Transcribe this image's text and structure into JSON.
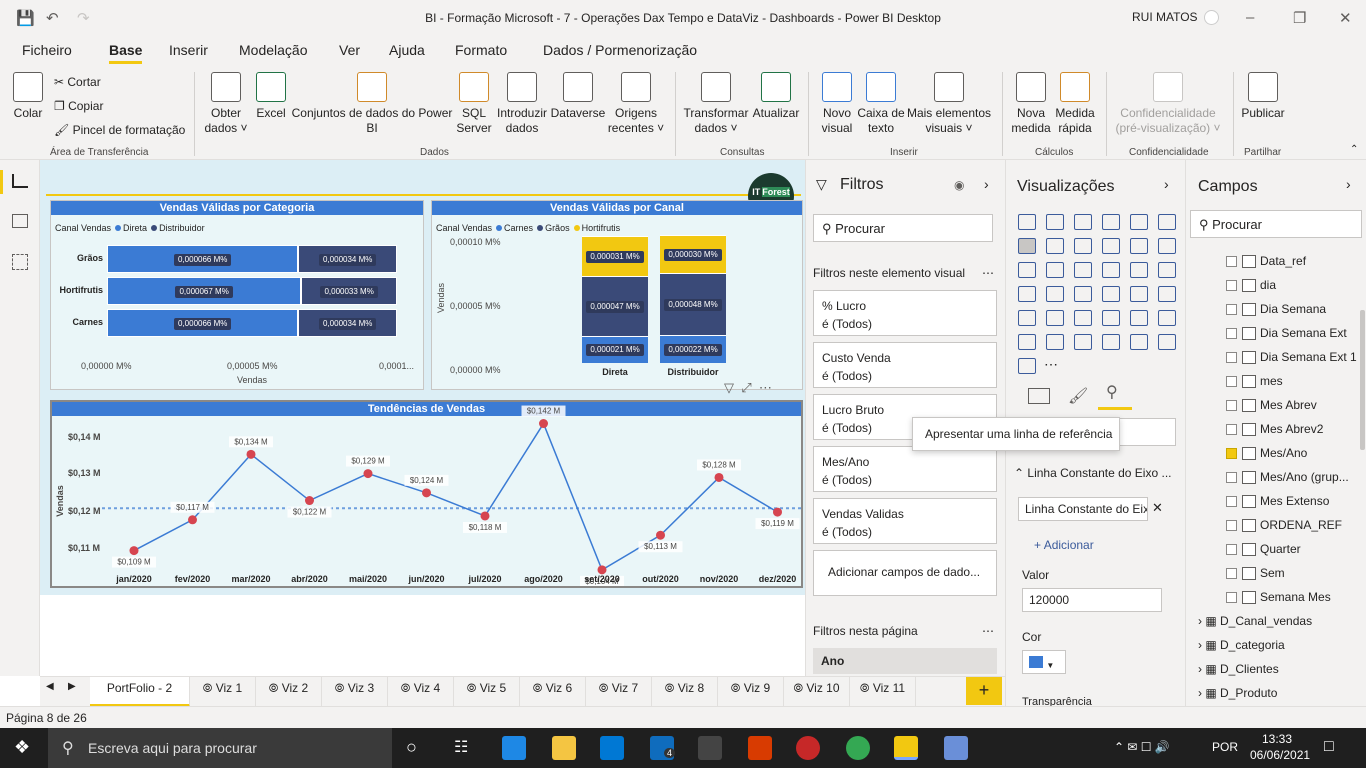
{
  "window": {
    "title": "BI - Formação Microsoft - 7 - Operações Dax Tempo e DataViz - Dashboards - Power BI Desktop",
    "user": "RUI MATOS"
  },
  "menu": [
    "Ficheiro",
    "Base",
    "Inserir",
    "Modelação",
    "Ver",
    "Ajuda",
    "Formato",
    "Dados / Pormenorização"
  ],
  "ribbon": {
    "colar": "Colar",
    "cortar": "Cortar",
    "copiar": "Copiar",
    "pincel": "Pincel de formatação",
    "g_transf": "Área de Transferência",
    "obter1": "Obter",
    "obter2": "dados",
    "excel": "Excel",
    "conj1": "Conjuntos de dados do Power",
    "conj2": "BI",
    "sql1": "SQL",
    "sql2": "Server",
    "intro1": "Introduzir",
    "intro2": "dados",
    "dataverse": "Dataverse",
    "orig1": "Origens",
    "orig2": "recentes",
    "g_dados": "Dados",
    "transf1": "Transformar",
    "transf2": "dados",
    "atual": "Atualizar",
    "g_consultas": "Consultas",
    "novo1": "Novo",
    "novo2": "visual",
    "caixa1": "Caixa de",
    "caixa2": "texto",
    "mais1": "Mais elementos",
    "mais2": "visuais",
    "g_inserir": "Inserir",
    "nova1": "Nova",
    "nova2": "medida",
    "med1": "Medida",
    "med2": "rápida",
    "g_calc": "Cálculos",
    "conf1": "Confidencialidade",
    "conf2": "(pré-visualização)",
    "g_conf": "Confidencialidade",
    "pub": "Publicar",
    "g_part": "Partilhar"
  },
  "logo": {
    "a": "IT",
    "b": "Forest"
  },
  "chart1": {
    "title": "Vendas Válidas por Categoria",
    "legend_title": "Canal Vendas",
    "legend": [
      "Direta",
      "Distribuidor"
    ],
    "xlabel": "Vendas",
    "xticks": [
      "0,00000 M%",
      "0,00005 M%",
      "0,0001..."
    ]
  },
  "chart2": {
    "title": "Vendas Válidas por Canal",
    "legend_title": "Canal Vendas",
    "legend": [
      "Carnes",
      "Grãos",
      "Hortifrutis"
    ],
    "ylabel": "Vendas",
    "yticks": [
      "0,00010 M%",
      "0,00005 M%",
      "0,00000 M%"
    ]
  },
  "chart3": {
    "title": "Tendências de Vendas",
    "ylabel": "Vendas",
    "yticks": [
      "$0,14 M",
      "$0,13 M",
      "$0,12 M",
      "$0,11 M"
    ]
  },
  "chart_data": [
    {
      "type": "bar",
      "title": "Vendas Válidas por Categoria",
      "categories": [
        "Grãos",
        "Hortifrutis",
        "Carnes"
      ],
      "series": [
        {
          "name": "Direta",
          "values": [
            6.6e-05,
            6.7e-05,
            6.6e-05
          ],
          "labels": [
            "0,000066 M%",
            "0,000067 M%",
            "0,000066 M%"
          ]
        },
        {
          "name": "Distribuidor",
          "values": [
            3.4e-05,
            3.3e-05,
            3.4e-05
          ],
          "labels": [
            "0,000034 M%",
            "0,000033 M%",
            "0,000034 M%"
          ]
        }
      ],
      "xlabel": "Vendas",
      "stacked": true,
      "orientation": "horizontal",
      "xlim": [
        0,
        0.0001
      ]
    },
    {
      "type": "bar",
      "title": "Vendas Válidas por Canal",
      "categories": [
        "Direta",
        "Distribuidor"
      ],
      "series": [
        {
          "name": "Carnes",
          "values": [
            2.1e-05,
            2.2e-05
          ],
          "labels": [
            "0,000021 M%",
            "0,000022 M%"
          ]
        },
        {
          "name": "Grãos",
          "values": [
            4.7e-05,
            4.8e-05
          ],
          "labels": [
            "0,000047 M%",
            "0,000048 M%"
          ]
        },
        {
          "name": "Hortifrutis",
          "values": [
            3.1e-05,
            3e-05
          ],
          "labels": [
            "0,000031 M%",
            "0,000030 M%"
          ]
        }
      ],
      "ylabel": "Vendas",
      "stacked": true,
      "ylim": [
        0,
        0.0001
      ]
    },
    {
      "type": "line",
      "title": "Tendências de Vendas",
      "categories": [
        "jan/2020",
        "fev/2020",
        "mar/2020",
        "abr/2020",
        "mai/2020",
        "jun/2020",
        "jul/2020",
        "ago/2020",
        "set/2020",
        "out/2020",
        "nov/2020",
        "dez/2020"
      ],
      "values": [
        0.109,
        0.117,
        0.134,
        0.122,
        0.129,
        0.124,
        0.118,
        0.142,
        0.104,
        0.113,
        0.128,
        0.119
      ],
      "labels": [
        "$0,109 M",
        "$0,117 M",
        "$0,134 M",
        "$0,122 M",
        "$0,129 M",
        "$0,124 M",
        "$0,118 M",
        "$0,142 M",
        "$0,104 M",
        "$0,113 M",
        "$0,128 M",
        "$0,119 M"
      ],
      "ylabel": "Vendas",
      "reference_line": 0.12,
      "ylim": [
        0.105,
        0.145
      ]
    }
  ],
  "filters": {
    "title": "Filtros",
    "search": "Procurar",
    "sec1": "Filtros neste elemento visual",
    "cards": [
      {
        "name": "% Lucro",
        "val": "é (Todos)"
      },
      {
        "name": "Custo Venda",
        "val": "é (Todos)"
      },
      {
        "name": "Lucro Bruto",
        "val": "é (Todos)"
      },
      {
        "name": "Mes/Ano",
        "val": "é (Todos)"
      },
      {
        "name": "Vendas Validas",
        "val": "é (Todos)"
      }
    ],
    "add": "Adicionar campos de dado...",
    "sec2": "Filtros nesta página",
    "ano": "Ano"
  },
  "viz": {
    "title": "Visualizações",
    "tooltip": "Apresentar uma linha de referência",
    "section": "Linha Constante do Eixo ...",
    "item": "Linha Constante do Eixo",
    "add": "Adicionar",
    "valor_label": "Valor",
    "valor": "120000",
    "cor_label": "Cor",
    "transp": "Transparência",
    "accent": "#3b7bd4"
  },
  "campos": {
    "title": "Campos",
    "search": "Procurar",
    "fields": [
      {
        "name": "Data_ref",
        "checked": false
      },
      {
        "name": "dia",
        "checked": false
      },
      {
        "name": "Dia Semana",
        "checked": false
      },
      {
        "name": "Dia Semana Ext",
        "checked": false
      },
      {
        "name": "Dia Semana Ext 1",
        "checked": false
      },
      {
        "name": "mes",
        "checked": false
      },
      {
        "name": "Mes Abrev",
        "checked": false
      },
      {
        "name": "Mes Abrev2",
        "checked": false
      },
      {
        "name": "Mes/Ano",
        "checked": true
      },
      {
        "name": "Mes/Ano (grup...",
        "checked": false
      },
      {
        "name": "Mes Extenso",
        "checked": false
      },
      {
        "name": "ORDENA_REF",
        "checked": false
      },
      {
        "name": "Quarter",
        "checked": false
      },
      {
        "name": "Sem",
        "checked": false
      },
      {
        "name": "Semana Mes",
        "checked": false
      }
    ],
    "tables": [
      "D_Canal_vendas",
      "D_categoria",
      "D_Clientes",
      "D_Produto"
    ]
  },
  "tabs": [
    "PortFolio - 2",
    "Viz 1",
    "Viz 2",
    "Viz 3",
    "Viz 4",
    "Viz 5",
    "Viz 6",
    "Viz 7",
    "Viz 8",
    "Viz 9",
    "Viz 10",
    "Viz 11"
  ],
  "status": "Página 8 de 26",
  "taskbar": {
    "search": "Escreva aqui para procurar",
    "lang": "POR",
    "time": "13:33",
    "date": "06/06/2021",
    "badge": "4"
  },
  "colors": {
    "direta": "#3b7bd4",
    "distribuidor": "#3a4a78",
    "carnes": "#3b7bd4",
    "graos": "#3a4a78",
    "hortifrutis": "#f2c811",
    "line": "#3b7bd4",
    "marker": "#d64550"
  }
}
